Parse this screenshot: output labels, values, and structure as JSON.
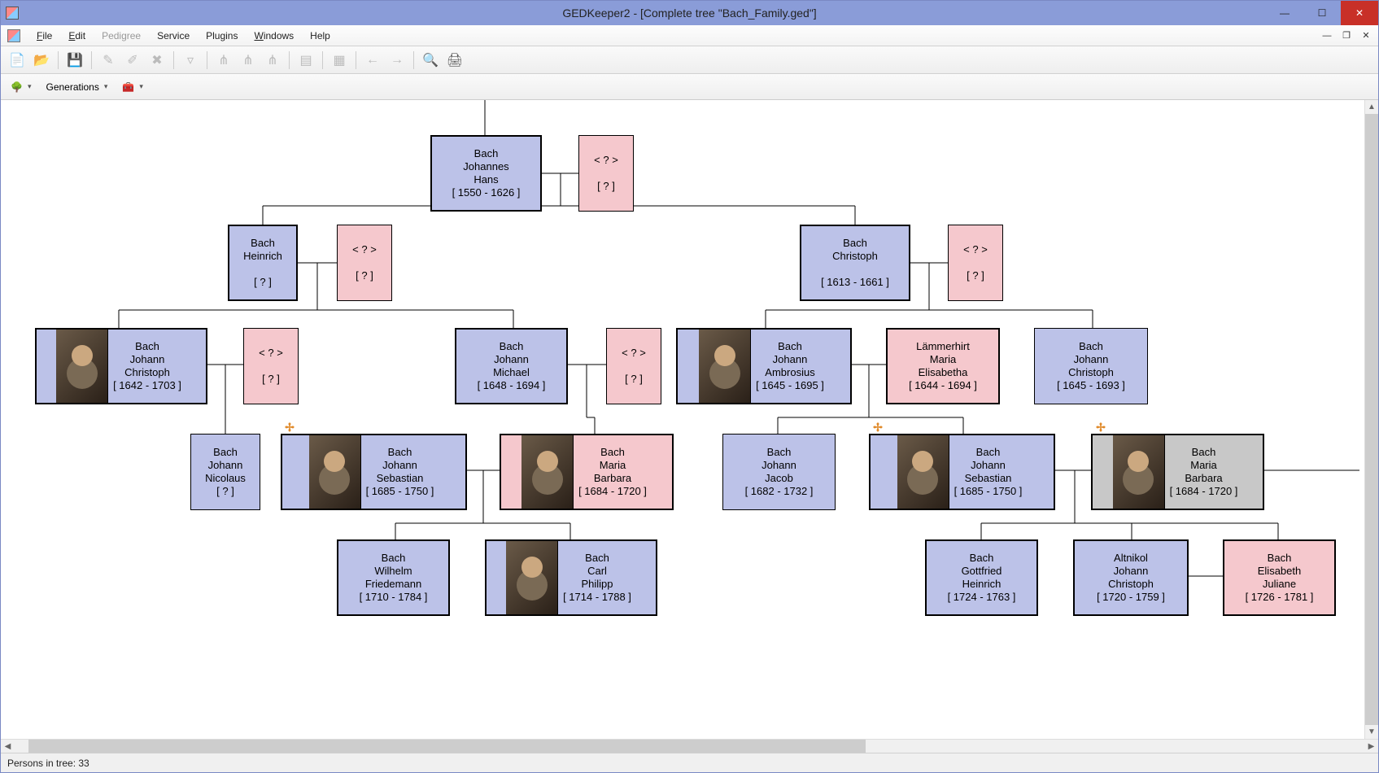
{
  "window": {
    "title": "GEDKeeper2 - [Complete tree \"Bach_Family.ged\"]"
  },
  "menu": {
    "items": [
      {
        "label": "File",
        "underline": "F",
        "enabled": true
      },
      {
        "label": "Edit",
        "underline": "E",
        "enabled": true
      },
      {
        "label": "Pedigree",
        "underline": "",
        "enabled": false
      },
      {
        "label": "Service",
        "underline": "S",
        "enabled": true
      },
      {
        "label": "Plugins",
        "underline": "P",
        "enabled": true
      },
      {
        "label": "Windows",
        "underline": "W",
        "enabled": true
      },
      {
        "label": "Help",
        "underline": "H",
        "enabled": true
      }
    ]
  },
  "toolbar2": {
    "generations_label": "Generations"
  },
  "status": {
    "persons_label": "Persons in tree: 33"
  },
  "nodes": {
    "g1_johannes": {
      "l1": "Bach",
      "l2": "Johannes",
      "l3": "Hans",
      "dates": "[ 1550 - 1626 ]"
    },
    "g1_unknown": {
      "l1": "< ? >",
      "dates": "[ ? ]"
    },
    "g2_heinrich": {
      "l1": "Bach",
      "l2": "Heinrich",
      "dates": "[ ? ]"
    },
    "g2_h_unk": {
      "l1": "< ? >",
      "dates": "[ ? ]"
    },
    "g2_christoph": {
      "l1": "Bach",
      "l2": "Christoph",
      "dates": "[ 1613 - 1661 ]"
    },
    "g2_c_unk": {
      "l1": "< ? >",
      "dates": "[ ? ]"
    },
    "g3_jc1": {
      "l1": "Bach",
      "l2": "Johann",
      "l3": "Christoph",
      "dates": "[ 1642 - 1703 ]"
    },
    "g3_jc1_unk": {
      "l1": "< ? >",
      "dates": "[ ? ]"
    },
    "g3_jmichael": {
      "l1": "Bach",
      "l2": "Johann",
      "l3": "Michael",
      "dates": "[ 1648 - 1694 ]"
    },
    "g3_jm_unk": {
      "l1": "< ? >",
      "dates": "[ ? ]"
    },
    "g3_jambros": {
      "l1": "Bach",
      "l2": "Johann",
      "l3": "Ambrosius",
      "dates": "[ 1645 - 1695 ]"
    },
    "g3_laemmer": {
      "l1": "Lämmerhirt",
      "l2": "Maria",
      "l3": "Elisabetha",
      "dates": "[ 1644 - 1694 ]"
    },
    "g3_jc2": {
      "l1": "Bach",
      "l2": "Johann",
      "l3": "Christoph",
      "dates": "[ 1645 - 1693 ]"
    },
    "g4_jnic": {
      "l1": "Bach",
      "l2": "Johann",
      "l3": "Nicolaus",
      "dates": "[ ? ]"
    },
    "g4_jsb": {
      "l1": "Bach",
      "l2": "Johann",
      "l3": "Sebastian",
      "dates": "[ 1685 - 1750 ]"
    },
    "g4_mbarbara": {
      "l1": "Bach",
      "l2": "Maria",
      "l3": "Barbara",
      "dates": "[ 1684 - 1720 ]"
    },
    "g4_jjacob": {
      "l1": "Bach",
      "l2": "Johann",
      "l3": "Jacob",
      "dates": "[ 1682 - 1732 ]"
    },
    "g4_jsb2": {
      "l1": "Bach",
      "l2": "Johann",
      "l3": "Sebastian",
      "dates": "[ 1685 - 1750 ]"
    },
    "g4_mbarbara2": {
      "l1": "Bach",
      "l2": "Maria",
      "l3": "Barbara",
      "dates": "[ 1684 - 1720 ]"
    },
    "g5_wfried": {
      "l1": "Bach",
      "l2": "Wilhelm",
      "l3": "Friedemann",
      "dates": "[ 1710 - 1784 ]"
    },
    "g5_cphilipp": {
      "l1": "Bach",
      "l2": "Carl",
      "l3": "Philipp",
      "dates": "[ 1714 - 1788 ]"
    },
    "g5_gottfr": {
      "l1": "Bach",
      "l2": "Gottfried",
      "l3": "Heinrich",
      "dates": "[ 1724 - 1763 ]"
    },
    "g5_altnikol": {
      "l1": "Altnikol",
      "l2": "Johann",
      "l3": "Christoph",
      "dates": "[ 1720 - 1759 ]"
    },
    "g5_elisab": {
      "l1": "Bach",
      "l2": "Elisabeth",
      "l3": "Juliane",
      "dates": "[ 1726 - 1781 ]"
    }
  }
}
